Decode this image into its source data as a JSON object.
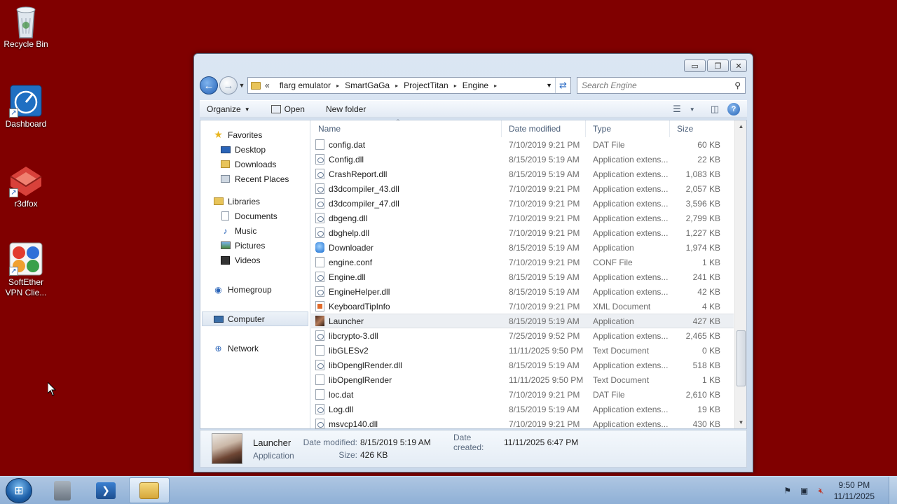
{
  "desktop": {
    "icons": [
      {
        "label": "Recycle Bin"
      },
      {
        "label": "Dashboard"
      },
      {
        "label": "r3dfox"
      },
      {
        "label": "SoftEther\nVPN Clie..."
      }
    ]
  },
  "window": {
    "breadcrumb": [
      "«",
      "flarg emulator",
      "SmartGaGa",
      "ProjectTitan",
      "Engine"
    ],
    "search_placeholder": "Search Engine",
    "toolbar": {
      "organize": "Organize",
      "open": "Open",
      "new_folder": "New folder"
    },
    "nav": {
      "favorites": "Favorites",
      "desktop": "Desktop",
      "downloads": "Downloads",
      "recent_places": "Recent Places",
      "libraries": "Libraries",
      "documents": "Documents",
      "music": "Music",
      "pictures": "Pictures",
      "videos": "Videos",
      "homegroup": "Homegroup",
      "computer": "Computer",
      "network": "Network"
    },
    "columns": {
      "name": "Name",
      "date": "Date modified",
      "type": "Type",
      "size": "Size"
    },
    "files": [
      {
        "name": "config.dat",
        "date": "7/10/2019 9:21 PM",
        "type": "DAT File",
        "size": "60 KB",
        "icon": "blank"
      },
      {
        "name": "Config.dll",
        "date": "8/15/2019 5:19 AM",
        "type": "Application extens...",
        "size": "22 KB",
        "icon": "dll"
      },
      {
        "name": "CrashReport.dll",
        "date": "8/15/2019 5:19 AM",
        "type": "Application extens...",
        "size": "1,083 KB",
        "icon": "dll"
      },
      {
        "name": "d3dcompiler_43.dll",
        "date": "7/10/2019 9:21 PM",
        "type": "Application extens...",
        "size": "2,057 KB",
        "icon": "dll"
      },
      {
        "name": "d3dcompiler_47.dll",
        "date": "7/10/2019 9:21 PM",
        "type": "Application extens...",
        "size": "3,596 KB",
        "icon": "dll"
      },
      {
        "name": "dbgeng.dll",
        "date": "7/10/2019 9:21 PM",
        "type": "Application extens...",
        "size": "2,799 KB",
        "icon": "dll"
      },
      {
        "name": "dbghelp.dll",
        "date": "7/10/2019 9:21 PM",
        "type": "Application extens...",
        "size": "1,227 KB",
        "icon": "dll"
      },
      {
        "name": "Downloader",
        "date": "8/15/2019 5:19 AM",
        "type": "Application",
        "size": "1,974 KB",
        "icon": "app"
      },
      {
        "name": "engine.conf",
        "date": "7/10/2019 9:21 PM",
        "type": "CONF File",
        "size": "1 KB",
        "icon": "blank"
      },
      {
        "name": "Engine.dll",
        "date": "8/15/2019 5:19 AM",
        "type": "Application extens...",
        "size": "241 KB",
        "icon": "dll"
      },
      {
        "name": "EngineHelper.dll",
        "date": "8/15/2019 5:19 AM",
        "type": "Application extens...",
        "size": "42 KB",
        "icon": "dll"
      },
      {
        "name": "KeyboardTipInfo",
        "date": "7/10/2019 9:21 PM",
        "type": "XML Document",
        "size": "4 KB",
        "icon": "xml"
      },
      {
        "name": "Launcher",
        "date": "8/15/2019 5:19 AM",
        "type": "Application",
        "size": "427 KB",
        "icon": "launcher"
      },
      {
        "name": "libcrypto-3.dll",
        "date": "7/25/2019 9:52 PM",
        "type": "Application extens...",
        "size": "2,465 KB",
        "icon": "dll"
      },
      {
        "name": "libGLESv2",
        "date": "11/11/2025 9:50 PM",
        "type": "Text Document",
        "size": "0 KB",
        "icon": "blank"
      },
      {
        "name": "libOpenglRender.dll",
        "date": "8/15/2019 5:19 AM",
        "type": "Application extens...",
        "size": "518 KB",
        "icon": "dll"
      },
      {
        "name": "libOpenglRender",
        "date": "11/11/2025 9:50 PM",
        "type": "Text Document",
        "size": "1 KB",
        "icon": "blank"
      },
      {
        "name": "loc.dat",
        "date": "7/10/2019 9:21 PM",
        "type": "DAT File",
        "size": "2,610 KB",
        "icon": "blank"
      },
      {
        "name": "Log.dll",
        "date": "8/15/2019 5:19 AM",
        "type": "Application extens...",
        "size": "19 KB",
        "icon": "dll"
      },
      {
        "name": "msvcp140.dll",
        "date": "7/10/2019 9:21 PM",
        "type": "Application extens...",
        "size": "430 KB",
        "icon": "dll"
      }
    ],
    "details": {
      "name": "Launcher",
      "kind": "Application",
      "date_modified_label": "Date modified:",
      "date_modified": "8/15/2019 5:19 AM",
      "size_label": "Size:",
      "size": "426 KB",
      "date_created_label": "Date created:",
      "date_created": "11/11/2025 6:47 PM"
    }
  },
  "taskbar": {
    "clock_time": "9:50 PM",
    "clock_date": "11/11/2025"
  },
  "colors": {
    "desktop_bg": "#800000",
    "taskbar": "#9fbcdc",
    "selection": "#eceff3"
  }
}
